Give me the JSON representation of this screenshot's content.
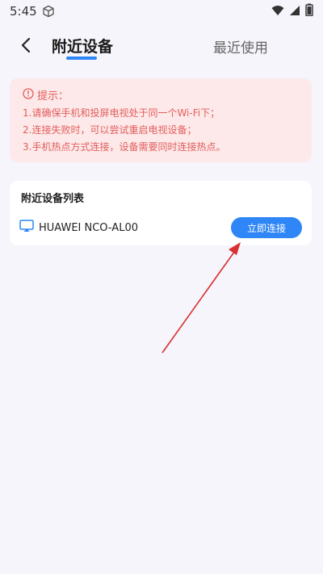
{
  "status_bar": {
    "time": "5:45",
    "icons": [
      "cube-icon",
      "wifi-icon",
      "cellular-signal-icon",
      "battery-icon"
    ]
  },
  "nav": {
    "tabs": [
      {
        "label": "附近设备",
        "active": true
      },
      {
        "label": "最近使用",
        "active": false
      }
    ],
    "back_icon": "back-chevron-icon"
  },
  "tips": {
    "icon": "info-circle-icon",
    "title": "提示：",
    "lines": [
      "1.请确保手机和投屏电视处于同一个Wi-Fi下；",
      "2.连接失败时，可以尝试重启电视设备；",
      "3.手机热点方式连接，设备需要同时连接热点。"
    ]
  },
  "device_list": {
    "title": "附近设备列表",
    "devices": [
      {
        "icon": "cast-screen-icon",
        "name": "HUAWEI NCO-AL00",
        "action_label": "立即连接"
      }
    ]
  },
  "colors": {
    "accent": "#2f86f6",
    "tip_text": "#e35d5d",
    "tip_bg": "#fde9e9",
    "annotation": "#d93030"
  }
}
